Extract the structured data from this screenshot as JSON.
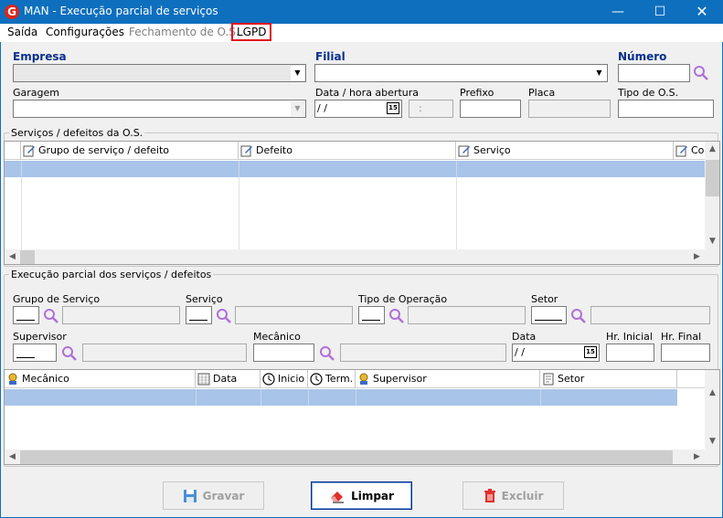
{
  "window": {
    "title": "MAN - Execução parcial de serviços",
    "app_icon": "G"
  },
  "menu": [
    "Saída",
    "Configurações",
    "Fechamento de O.S.",
    "LGPD"
  ],
  "top_form": {
    "empresa": "Empresa",
    "filial": "Filial",
    "numero": "Número",
    "garagem": "Garagem",
    "data_hora": "Data / hora abertura",
    "prefixo": "Prefixo",
    "placa": "Placa",
    "tipo_os": "Tipo de O.S.",
    "date_value": " /  /",
    "time_value": ":"
  },
  "servicos_group": {
    "title": "Serviços / defeitos da O.S.",
    "columns": [
      "Grupo de serviço / defeito",
      "Defeito",
      "Serviço",
      "Co"
    ]
  },
  "execucao_group": {
    "title": "Execução parcial dos serviços / defeitos",
    "grupo_servico": "Grupo de Serviço",
    "servico": "Serviço",
    "tipo_operacao": "Tipo de Operação",
    "setor": "Setor",
    "supervisor": "Supervisor",
    "mecanico": "Mecânico",
    "data": "Data",
    "hr_inicial": "Hr. Inicial",
    "hr_final": "Hr. Final",
    "date_value": " /  /",
    "columns": [
      "Mecânico",
      "Data",
      "Inicio",
      "Term.",
      "Supervisor",
      "Setor"
    ]
  },
  "buttons": {
    "gravar": "Gravar",
    "limpar": "Limpar",
    "excluir": "Excluir"
  },
  "colors": {
    "titlebar": "#0d6fbe",
    "label_bold": "#0a2f8c",
    "selection": "#a8c4e8",
    "highlight": "#e0141e"
  }
}
